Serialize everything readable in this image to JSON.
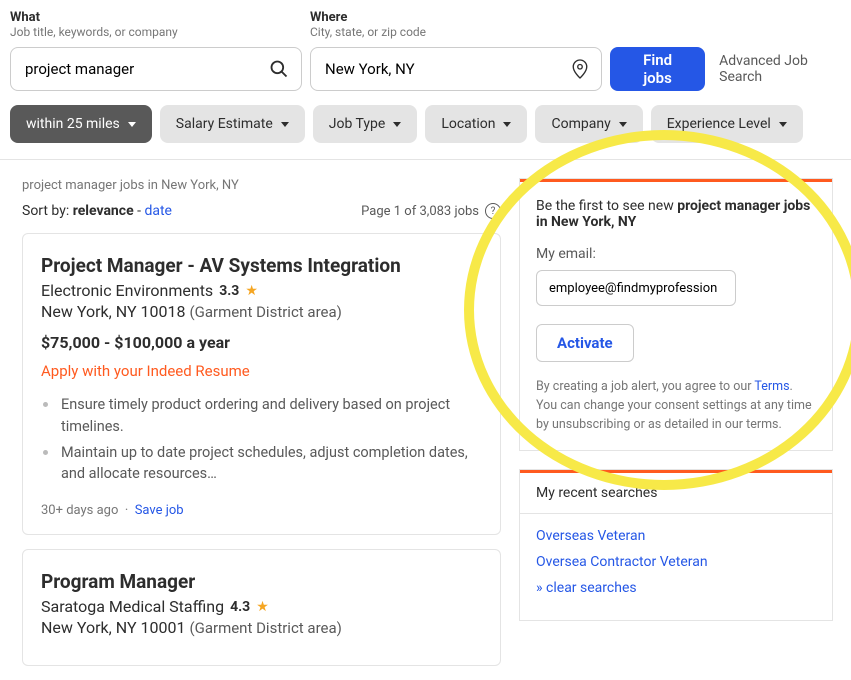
{
  "search": {
    "what_label": "What",
    "what_sub": "Job title, keywords, or company",
    "where_label": "Where",
    "where_sub": "City, state, or zip code",
    "what_value": "project manager",
    "where_value": "New York, NY",
    "find_button": "Find jobs",
    "advanced": "Advanced Job Search"
  },
  "filters": [
    {
      "label": "within 25 miles",
      "active": true
    },
    {
      "label": "Salary Estimate",
      "active": false
    },
    {
      "label": "Job Type",
      "active": false
    },
    {
      "label": "Location",
      "active": false
    },
    {
      "label": "Company",
      "active": false
    },
    {
      "label": "Experience Level",
      "active": false
    }
  ],
  "results": {
    "summary": "project manager jobs in New York, NY",
    "sort_prefix": "Sort by: ",
    "sort_active": "relevance",
    "sort_sep": " - ",
    "sort_alt": "date",
    "page_info": "Page 1 of 3,083 jobs"
  },
  "jobs": [
    {
      "title": "Project Manager - AV Systems Integration",
      "company": "Electronic Environments",
      "rating": "3.3",
      "city": "New York, NY 10018",
      "area": "(Garment District area)",
      "salary": "$75,000 - $100,000 a year",
      "apply": "Apply with your Indeed Resume",
      "bullets": [
        "Ensure timely product ordering and delivery based on project timelines.",
        "Maintain up to date project schedules, adjust completion dates, and allocate resources…"
      ],
      "posted": "30+ days ago",
      "sep": "·",
      "save": "Save job"
    },
    {
      "title": "Program Manager",
      "company": "Saratoga Medical Staffing",
      "rating": "4.3",
      "city": "New York, NY 10001",
      "area": "(Garment District area)"
    }
  ],
  "alert": {
    "prefix": "Be the first to see new ",
    "bold": "project manager jobs in New York, NY",
    "email_label": "My email:",
    "email_value": "employee@findmyprofession",
    "activate": "Activate",
    "disclaimer_1": "By creating a job alert, you agree to our ",
    "terms": "Terms",
    "disclaimer_2": ". You can change your consent settings at any time by unsubscribing or as detailed in our terms."
  },
  "recent": {
    "header": "My recent searches",
    "items": [
      "Overseas Veteran",
      "Oversea Contractor Veteran"
    ],
    "clear": "» clear searches"
  }
}
